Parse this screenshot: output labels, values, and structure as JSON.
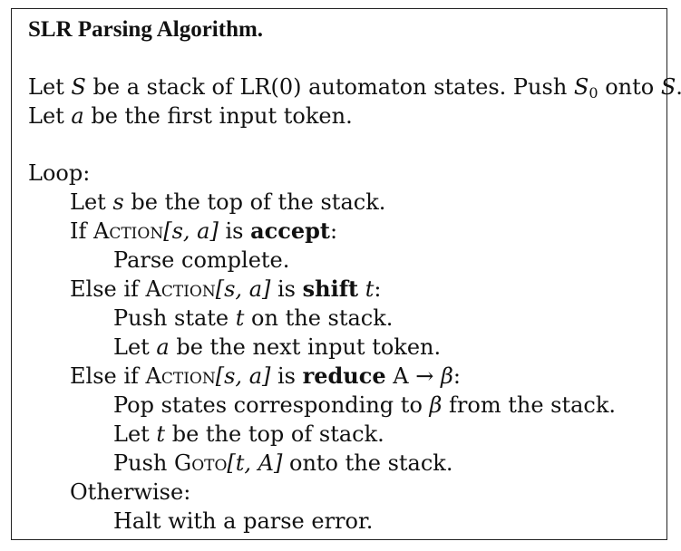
{
  "title": "SLR Parsing Algorithm.",
  "init_line1": {
    "t1": "Let ",
    "S1": "S",
    "t2": " be a stack of LR(0) automaton states. Push ",
    "S2": "S",
    "sub0": "0",
    "t3": " onto ",
    "S3": "S",
    "t4": "."
  },
  "init_line2": {
    "t1": "Let ",
    "a": "a",
    "t2": " be the first input token."
  },
  "loop": "Loop:",
  "let_s": {
    "t1": "Let ",
    "s": "s",
    "t2": " be the top of the stack."
  },
  "if_accept": {
    "t1": "If ",
    "action": "Action",
    "args": "[s, a]",
    "t2": " is ",
    "kw": "accept",
    "t3": ":"
  },
  "parse_complete": "Parse complete.",
  "elseif_shift": {
    "t1": "Else if ",
    "action": "Action",
    "args": "[s, a]",
    "t2": " is ",
    "kw": "shift",
    "t3": " ",
    "t": "t",
    "t4": ":"
  },
  "push_state": {
    "t1": "Push state ",
    "t": "t",
    "t2": " on the stack."
  },
  "let_a_next": {
    "t1": "Let ",
    "a": "a",
    "t2": " be the next input token."
  },
  "elseif_reduce": {
    "t1": "Else if ",
    "action": "Action",
    "args": "[s, a]",
    "t2": " is ",
    "kw": "reduce",
    "t3": " A → ",
    "beta": "β",
    "t4": ":"
  },
  "pop_states": {
    "t1": "Pop states corresponding to ",
    "beta": "β",
    "t2": " from the stack."
  },
  "let_t_top": {
    "t1": "Let ",
    "t": "t",
    "t2": " be the top of stack."
  },
  "push_goto": {
    "t1": "Push ",
    "goto": "Goto",
    "args": "[t, A]",
    "t2": " onto the stack."
  },
  "otherwise": "Otherwise:",
  "halt": "Halt with a parse error."
}
